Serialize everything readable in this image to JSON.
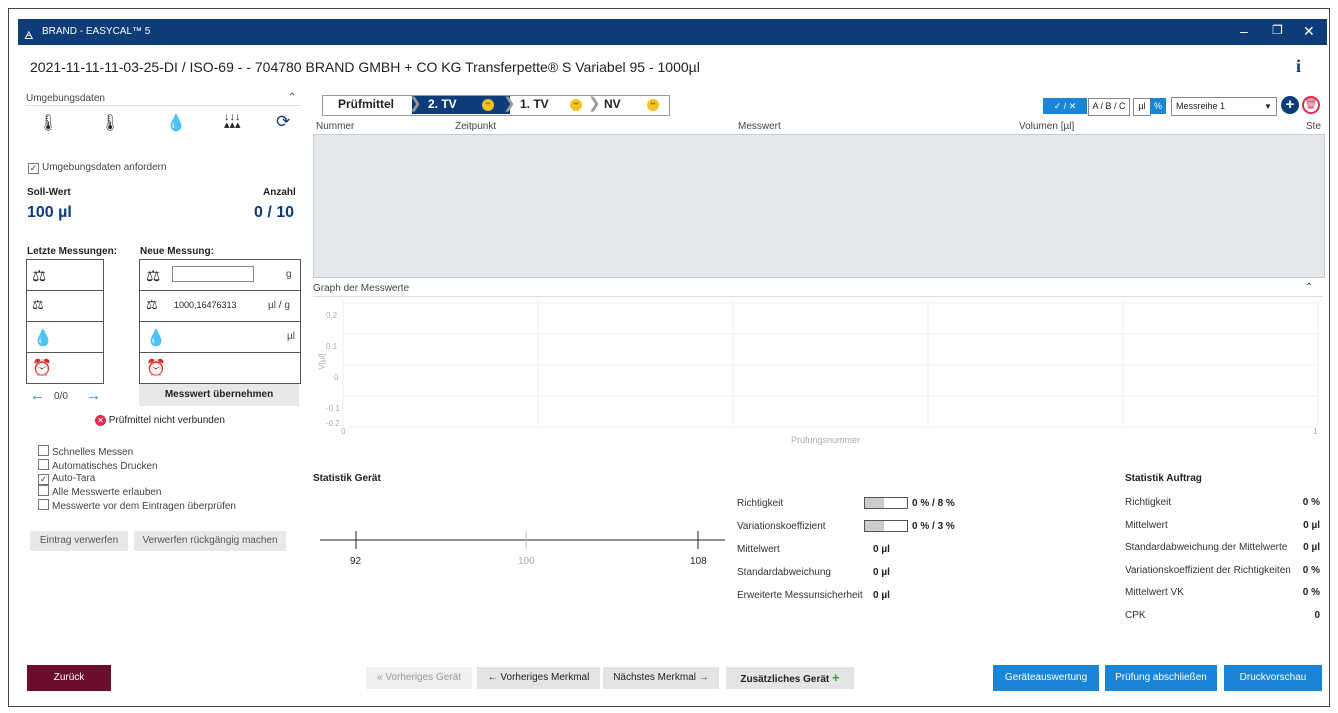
{
  "window": {
    "title": "BRAND - EASYCAL™ 5"
  },
  "header": {
    "title": "2021-11-11-11-03-25-DI / ISO-69 - - 704780 BRAND GMBH + CO KG Transferpette® S Variabel 95 - 1000µl",
    "info": "i"
  },
  "left": {
    "umgebung": "Umgebungsdaten",
    "anfordern": "Umgebungsdaten anfordern",
    "soll_label": "Soll-Wert",
    "anzahl_label": "Anzahl",
    "soll_value": "100 µl",
    "anzahl_value": "0 / 10",
    "letzte": "Letzte Messungen:",
    "neue": "Neue Messung:",
    "unit_g": "g",
    "density_value": "1000,16476313",
    "unit_ulg": "µl / g",
    "unit_ul": "µl",
    "nav_counter": "0/0",
    "uebernehmen": "Messwert übernehmen",
    "error": "Prüfmittel nicht verbunden",
    "options": [
      "Schnelles Messen",
      "Automatisches Drucken",
      "Auto-Tara",
      "Alle Messwerte erlauben",
      "Messwerte vor dem Eintragen überprüfen"
    ],
    "options_checked": [
      false,
      false,
      true,
      false,
      false
    ],
    "verwerfen": "Eintrag verwerfen",
    "rueck": "Verwerfen rückgängig machen"
  },
  "tabs": [
    "Prüfmittel",
    "2. TV",
    "1. TV",
    "NV"
  ],
  "toolbar": {
    "vx": "✓ / ✕",
    "abc": "A / B / C",
    "ul": "µl",
    "pct": "%",
    "series": "Messreihe 1"
  },
  "table": {
    "cols": [
      "Nummer",
      "Zeitpunkt",
      "Messwert",
      "Volumen [µl]",
      "Ste"
    ]
  },
  "graph": {
    "title": "Graph der Messwerte",
    "y_ticks": [
      "0.2",
      "0.1",
      "0",
      "-0.1",
      "-0.2"
    ],
    "x_start": "0",
    "x_end": "1",
    "xlabel": "Prüfungsnummer",
    "ylabel": "V[µl]"
  },
  "stat_geraet": {
    "title": "Statistik Gerät",
    "scale": [
      "92",
      "100",
      "108"
    ],
    "rows": [
      {
        "label": "Richtigkeit",
        "value": "0 % / 8 %",
        "fill": 0.45
      },
      {
        "label": "Variationskoeffizient",
        "value": "0 % / 3 %",
        "fill": 0.45
      },
      {
        "label": "Mittelwert",
        "value": "0 µl"
      },
      {
        "label": "Standardabweichung",
        "value": "0 µl"
      },
      {
        "label": "Erweiterte Messunsicherheit",
        "value": "0 µl"
      }
    ]
  },
  "stat_auftrag": {
    "title": "Statistik Auftrag",
    "rows": [
      {
        "label": "Richtigkeit",
        "value": "0 %"
      },
      {
        "label": "Mittelwert",
        "value": "0 µl"
      },
      {
        "label": "Standardabweichung der Mittelwerte",
        "value": "0 µl"
      },
      {
        "label": "Variationskoeffizient der Richtigkeiten",
        "value": "0 %"
      },
      {
        "label": "Mittelwert VK",
        "value": "0 %"
      },
      {
        "label": "CPK",
        "value": "0"
      }
    ]
  },
  "footer": {
    "zurueck": "Zurück",
    "prev_geraet": "Vorheriges Gerät",
    "prev_merkmal": "Vorheriges Merkmal",
    "next_merkmal": "Nächstes Merkmal",
    "zusatz": "Zusätzliches Gerät",
    "auswertung": "Geräteauswertung",
    "abschliessen": "Prüfung abschließen",
    "druck": "Druckvorschau"
  }
}
